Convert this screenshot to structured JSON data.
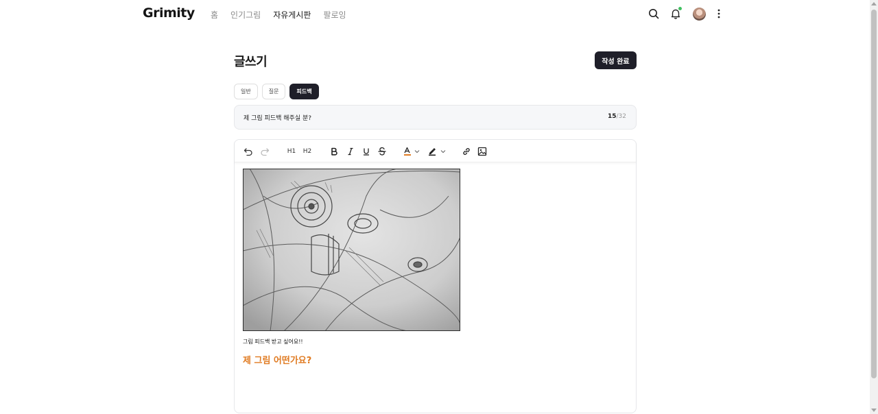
{
  "header": {
    "logo": "Grimity",
    "nav": [
      "홈",
      "인기그림",
      "자유게시판",
      "팔로잉"
    ],
    "active_nav": "자유게시판",
    "icons": [
      "search-icon",
      "bell-icon",
      "avatar",
      "more-vertical-icon"
    ],
    "notification_dot_color": "#3fc05f"
  },
  "page": {
    "title": "글쓰기",
    "submit_label": "작성 완료"
  },
  "categories": {
    "items": [
      "일반",
      "질문",
      "피드백"
    ],
    "selected": "피드백"
  },
  "title_field": {
    "value": "제 그림 피드백 해주실 분?",
    "count": "15",
    "max": "/32"
  },
  "toolbar": {
    "items": [
      "undo",
      "redo",
      "H1",
      "H2",
      "bold",
      "italic",
      "underline",
      "strikethrough",
      "text-color",
      "highlight",
      "link",
      "image"
    ],
    "h1_label": "H1",
    "h2_label": "H2",
    "text_color_accent": "#e07b22"
  },
  "content": {
    "image_alt": "pencil drawing",
    "paragraph": "그림 피드백 받고 싶어요!!",
    "heading": "제 그림 어떤가요?",
    "heading_color": "#e07b22"
  },
  "colors": {
    "primary_dark": "#1f1f29"
  }
}
